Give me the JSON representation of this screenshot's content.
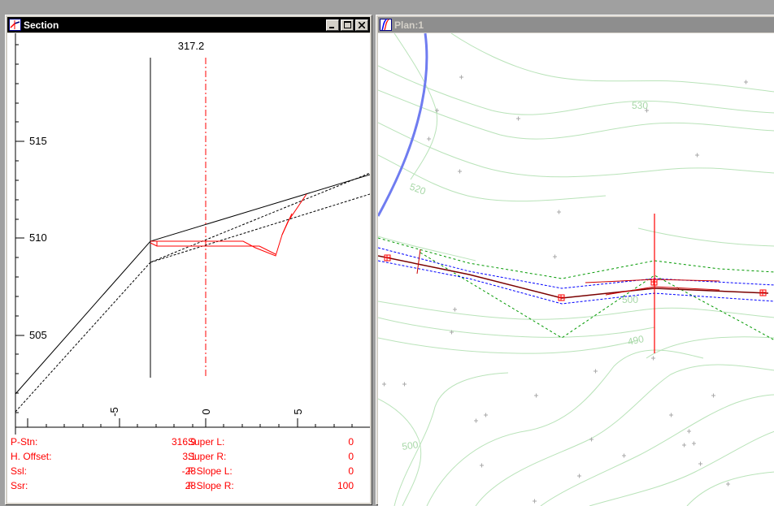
{
  "section_window": {
    "title": "Section",
    "icon": "section-app-icon",
    "controls": [
      "minimize-icon",
      "maximize-icon",
      "close-icon"
    ],
    "station_marker": "317.2",
    "elevation_labels": [
      "515",
      "510",
      "505"
    ],
    "offset_labels": [
      "-5",
      "0",
      "5"
    ],
    "info": [
      {
        "label": "P-Stn:",
        "value": "316.9",
        "label2": "Super L:",
        "value2": "0"
      },
      {
        "label": "H. Offset:",
        "value": "3.1",
        "label2": "Super R:",
        "value2": "0"
      },
      {
        "label": "Ssl:",
        "value": "-28",
        "label2": "F Slope L:",
        "value2": "0"
      },
      {
        "label": "Ssr:",
        "value": "28",
        "label2": "F Slope R:",
        "value2": "100"
      }
    ],
    "colors": {
      "design": "#ff0000",
      "ground": "#000000"
    }
  },
  "plan_window": {
    "title": "Plan:1",
    "icon": "plan-app-icon",
    "contour_labels": [
      "530",
      "520",
      "500",
      "490",
      "500"
    ],
    "colors": {
      "contour": "#9fd59f",
      "alignment": "#cc0000",
      "offset": "#0000ff",
      "daylight": "#009900",
      "river": "#6f7cf0"
    }
  }
}
